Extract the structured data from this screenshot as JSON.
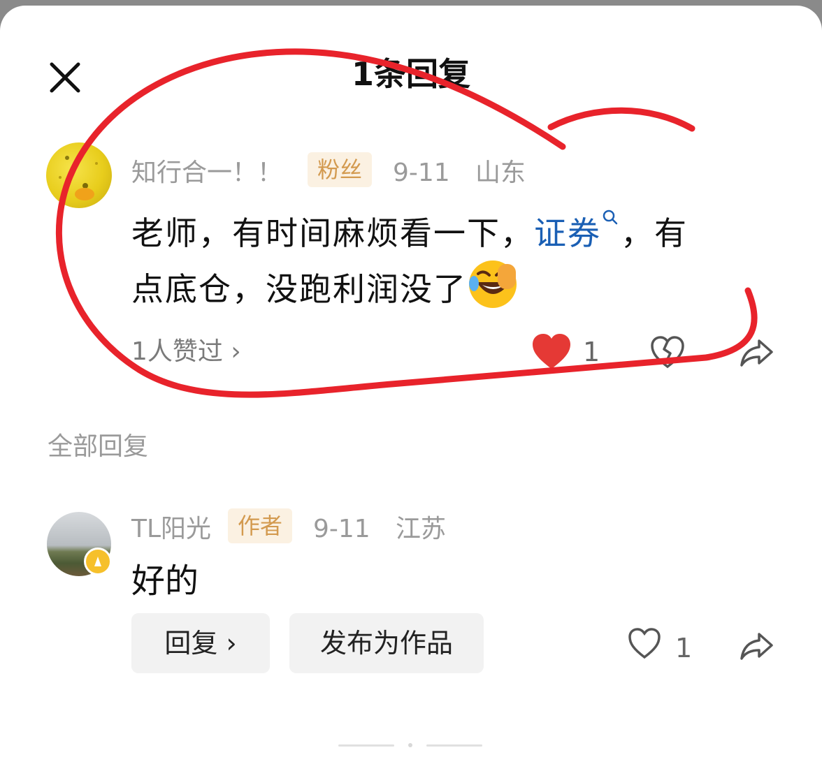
{
  "sheet": {
    "title": "1条回复"
  },
  "main_comment": {
    "username": "知行合一！！",
    "badge": "粉丝",
    "date": "9-11",
    "location": "山东",
    "text_line1_a": "老师，有时间麻烦看一下，",
    "link_text": "证券",
    "text_line1_b": "，有",
    "text_line2": "点底仓，没跑利润没了",
    "likes_summary": "1人赞过 ›",
    "like_count": "1"
  },
  "section": {
    "title": "全部回复"
  },
  "reply": {
    "username": "TL阳光",
    "badge": "作者",
    "date": "9-11",
    "location": "江苏",
    "text": "好的",
    "reply_button": "回复 ›",
    "publish_button": "发布为作品",
    "like_count": "1"
  },
  "colors": {
    "link": "#1a5fb4",
    "badge_text": "#d39a4f",
    "badge_bg": "#fbf1e2",
    "like_red": "#e53935",
    "annotation_red": "#e8232b"
  },
  "icons": [
    "close-icon",
    "search-icon",
    "laughing-emoji-icon",
    "heart-icon",
    "dislike-icon",
    "share-icon",
    "verified-badge-icon"
  ]
}
